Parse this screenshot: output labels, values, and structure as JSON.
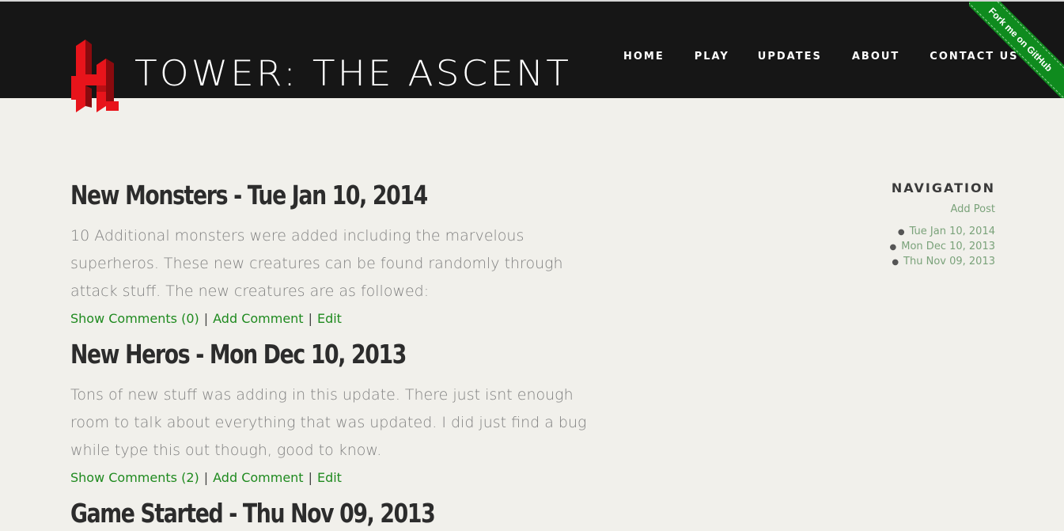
{
  "header": {
    "site_title": "TOWER: THE ASCENT",
    "nav": [
      {
        "label": "HOME"
      },
      {
        "label": "PLAY"
      },
      {
        "label": "UPDATES"
      },
      {
        "label": "ABOUT"
      },
      {
        "label": "CONTACT US"
      }
    ],
    "fork_ribbon": "Fork me on GitHub"
  },
  "posts": [
    {
      "title": "New Monsters - Tue Jan 10, 2014",
      "body": "10 Additional monsters were added including the marvelous superheros. These new creatures can be found randomly through attack stuff. The new creatures are as followed:",
      "show_comments": "Show Comments (0)",
      "add_comment": "Add Comment",
      "edit": "Edit"
    },
    {
      "title": "New Heros - Mon Dec 10, 2013",
      "body": "Tons of new stuff was adding in this update. There just isnt enough room to talk about everything that was updated. I did just find a bug while type this out though, good to know.",
      "show_comments": "Show Comments (2)",
      "add_comment": "Add Comment",
      "edit": "Edit"
    },
    {
      "title": "Game Started - Thu Nov 09, 2013"
    }
  ],
  "separators": {
    "pipe": "|"
  },
  "sidebar": {
    "title": "NAVIGATION",
    "add_post": "Add Post",
    "archive": [
      {
        "label": "Tue Jan 10, 2014"
      },
      {
        "label": "Mon Dec 10, 2013"
      },
      {
        "label": "Thu Nov 09, 2013"
      }
    ]
  },
  "colors": {
    "header_bg": "#161616",
    "page_bg": "#f1f0eb",
    "link_green": "#1f8a1f",
    "ribbon_green": "#0f8b1e",
    "logo_red": "#e8141b"
  }
}
